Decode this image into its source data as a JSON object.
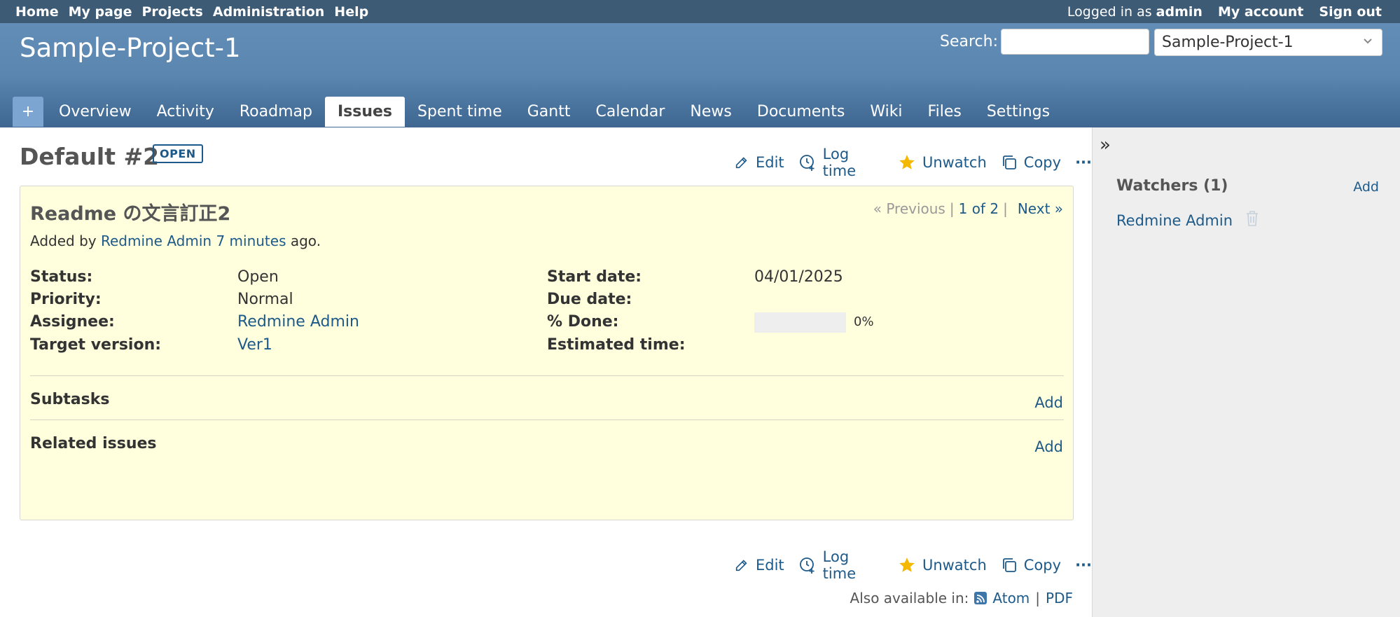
{
  "top_menu": {
    "items": [
      "Home",
      "My page",
      "Projects",
      "Administration",
      "Help"
    ],
    "logged_in_prefix": "Logged in as",
    "logged_in_user": "admin",
    "my_account": "My account",
    "sign_out": "Sign out"
  },
  "header": {
    "project_title": "Sample-Project-1",
    "search_label": "Search:",
    "search_value": "",
    "project_jump": "Sample-Project-1"
  },
  "main_menu": {
    "new_object": "+",
    "tabs": [
      "Overview",
      "Activity",
      "Roadmap",
      "Issues",
      "Spent time",
      "Gantt",
      "Calendar",
      "News",
      "Documents",
      "Wiki",
      "Files",
      "Settings"
    ],
    "selected": "Issues"
  },
  "issue": {
    "title": "Default #2",
    "status_badge": "OPEN",
    "actions": {
      "edit": "Edit",
      "log_time": "Log time",
      "unwatch": "Unwatch",
      "copy": "Copy",
      "more": "···"
    },
    "subject": "Readme の文言訂正2",
    "nav": {
      "previous": "« Previous",
      "sep1": "|",
      "count": "1 of 2",
      "sep2": "|",
      "next": "Next »"
    },
    "author": {
      "prefix": "Added by",
      "name": "Redmine Admin",
      "time": "7 minutes",
      "suffix": "ago."
    },
    "attributes": {
      "status_label": "Status:",
      "status": "Open",
      "priority_label": "Priority:",
      "priority": "Normal",
      "assignee_label": "Assignee:",
      "assignee": "Redmine Admin",
      "target_version_label": "Target version:",
      "target_version": "Ver1",
      "start_date_label": "Start date:",
      "start_date": "04/01/2025",
      "due_date_label": "Due date:",
      "due_date": "",
      "done_label": "% Done:",
      "done_text": "0%",
      "done_fraction": 0,
      "estimated_label": "Estimated time:",
      "estimated": ""
    },
    "subtasks": {
      "title": "Subtasks",
      "add": "Add"
    },
    "related": {
      "title": "Related issues",
      "add": "Add"
    },
    "also_available": {
      "prefix": "Also available in:",
      "atom": "Atom",
      "sep": "|",
      "pdf": "PDF"
    }
  },
  "sidebar": {
    "collapse": "»",
    "watchers_title": "Watchers (1)",
    "watchers_add": "Add",
    "watchers": [
      "Redmine Admin"
    ]
  },
  "colors": {
    "link": "#1d5a8a",
    "header": "#628db6",
    "top_menu": "#3e5b76",
    "issue_bg": "#ffffdd",
    "star": "#f5b800"
  }
}
